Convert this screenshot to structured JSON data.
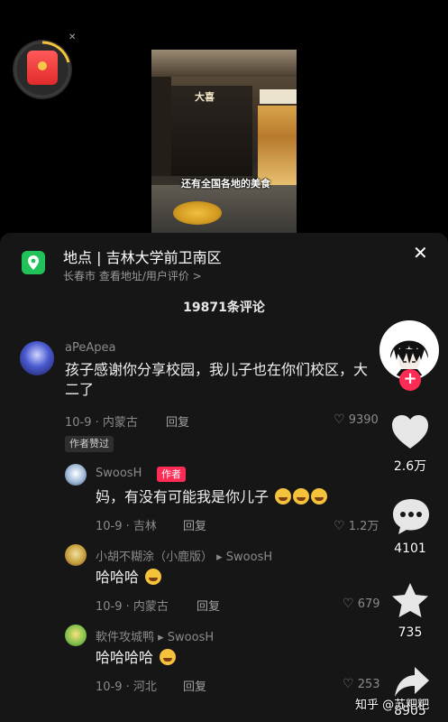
{
  "video": {
    "caption": "还有全国各地的美食",
    "shop_sign": "大喜"
  },
  "location": {
    "title": "地点 | 吉林大学前卫南区",
    "subtitle": "长春市  查看地址/用户评价 >"
  },
  "comment_count": "19871条评论",
  "comments": [
    {
      "name": "aPeApea",
      "text": "孩子感谢你分享校园，我儿子也在你们校区，大二了",
      "date": "10-9 · 内蒙古",
      "reply": "回复",
      "likes": "9390",
      "author_liked": "作者赞过"
    },
    {
      "name": "SwoosH",
      "badge": "作者",
      "text": "妈，有没有可能我是你儿子",
      "date": "10-9 · 吉林",
      "reply": "回复",
      "likes": "1.2万"
    },
    {
      "name": "小胡不糊涂（小鹿版） ▸ SwoosH",
      "text": "哈哈哈",
      "date": "10-9 · 内蒙古",
      "reply": "回复",
      "likes": "679"
    },
    {
      "name": "軟件攻城鸭 ▸ SwoosH",
      "text": "哈哈哈哈",
      "date": "10-9 · 河北",
      "reply": "回复",
      "likes": "253"
    }
  ],
  "sidebar": {
    "like_count": "2.6万",
    "comment_count": "4101",
    "favorite_count": "735",
    "share_count": "8905"
  },
  "watermark": "知乎 @苏粑粑",
  "colors": {
    "accent": "#fe2c55",
    "panel_bg": "#161616",
    "location_green": "#22c25a"
  },
  "icons": [
    "red-packet-icon",
    "location-pin-icon",
    "close-icon",
    "heart-icon",
    "comment-icon",
    "star-icon",
    "share-icon",
    "plus-icon"
  ]
}
